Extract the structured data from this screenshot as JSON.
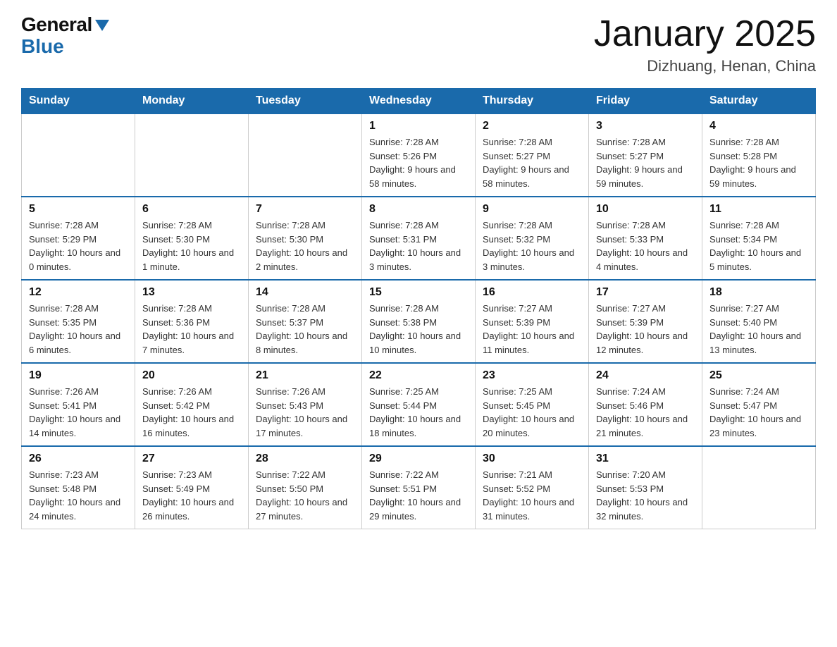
{
  "logo": {
    "general": "General",
    "blue": "Blue"
  },
  "title": "January 2025",
  "subtitle": "Dizhuang, Henan, China",
  "weekdays": [
    "Sunday",
    "Monday",
    "Tuesday",
    "Wednesday",
    "Thursday",
    "Friday",
    "Saturday"
  ],
  "weeks": [
    [
      {
        "day": "",
        "info": ""
      },
      {
        "day": "",
        "info": ""
      },
      {
        "day": "",
        "info": ""
      },
      {
        "day": "1",
        "info": "Sunrise: 7:28 AM\nSunset: 5:26 PM\nDaylight: 9 hours\nand 58 minutes."
      },
      {
        "day": "2",
        "info": "Sunrise: 7:28 AM\nSunset: 5:27 PM\nDaylight: 9 hours\nand 58 minutes."
      },
      {
        "day": "3",
        "info": "Sunrise: 7:28 AM\nSunset: 5:27 PM\nDaylight: 9 hours\nand 59 minutes."
      },
      {
        "day": "4",
        "info": "Sunrise: 7:28 AM\nSunset: 5:28 PM\nDaylight: 9 hours\nand 59 minutes."
      }
    ],
    [
      {
        "day": "5",
        "info": "Sunrise: 7:28 AM\nSunset: 5:29 PM\nDaylight: 10 hours\nand 0 minutes."
      },
      {
        "day": "6",
        "info": "Sunrise: 7:28 AM\nSunset: 5:30 PM\nDaylight: 10 hours\nand 1 minute."
      },
      {
        "day": "7",
        "info": "Sunrise: 7:28 AM\nSunset: 5:30 PM\nDaylight: 10 hours\nand 2 minutes."
      },
      {
        "day": "8",
        "info": "Sunrise: 7:28 AM\nSunset: 5:31 PM\nDaylight: 10 hours\nand 3 minutes."
      },
      {
        "day": "9",
        "info": "Sunrise: 7:28 AM\nSunset: 5:32 PM\nDaylight: 10 hours\nand 3 minutes."
      },
      {
        "day": "10",
        "info": "Sunrise: 7:28 AM\nSunset: 5:33 PM\nDaylight: 10 hours\nand 4 minutes."
      },
      {
        "day": "11",
        "info": "Sunrise: 7:28 AM\nSunset: 5:34 PM\nDaylight: 10 hours\nand 5 minutes."
      }
    ],
    [
      {
        "day": "12",
        "info": "Sunrise: 7:28 AM\nSunset: 5:35 PM\nDaylight: 10 hours\nand 6 minutes."
      },
      {
        "day": "13",
        "info": "Sunrise: 7:28 AM\nSunset: 5:36 PM\nDaylight: 10 hours\nand 7 minutes."
      },
      {
        "day": "14",
        "info": "Sunrise: 7:28 AM\nSunset: 5:37 PM\nDaylight: 10 hours\nand 8 minutes."
      },
      {
        "day": "15",
        "info": "Sunrise: 7:28 AM\nSunset: 5:38 PM\nDaylight: 10 hours\nand 10 minutes."
      },
      {
        "day": "16",
        "info": "Sunrise: 7:27 AM\nSunset: 5:39 PM\nDaylight: 10 hours\nand 11 minutes."
      },
      {
        "day": "17",
        "info": "Sunrise: 7:27 AM\nSunset: 5:39 PM\nDaylight: 10 hours\nand 12 minutes."
      },
      {
        "day": "18",
        "info": "Sunrise: 7:27 AM\nSunset: 5:40 PM\nDaylight: 10 hours\nand 13 minutes."
      }
    ],
    [
      {
        "day": "19",
        "info": "Sunrise: 7:26 AM\nSunset: 5:41 PM\nDaylight: 10 hours\nand 14 minutes."
      },
      {
        "day": "20",
        "info": "Sunrise: 7:26 AM\nSunset: 5:42 PM\nDaylight: 10 hours\nand 16 minutes."
      },
      {
        "day": "21",
        "info": "Sunrise: 7:26 AM\nSunset: 5:43 PM\nDaylight: 10 hours\nand 17 minutes."
      },
      {
        "day": "22",
        "info": "Sunrise: 7:25 AM\nSunset: 5:44 PM\nDaylight: 10 hours\nand 18 minutes."
      },
      {
        "day": "23",
        "info": "Sunrise: 7:25 AM\nSunset: 5:45 PM\nDaylight: 10 hours\nand 20 minutes."
      },
      {
        "day": "24",
        "info": "Sunrise: 7:24 AM\nSunset: 5:46 PM\nDaylight: 10 hours\nand 21 minutes."
      },
      {
        "day": "25",
        "info": "Sunrise: 7:24 AM\nSunset: 5:47 PM\nDaylight: 10 hours\nand 23 minutes."
      }
    ],
    [
      {
        "day": "26",
        "info": "Sunrise: 7:23 AM\nSunset: 5:48 PM\nDaylight: 10 hours\nand 24 minutes."
      },
      {
        "day": "27",
        "info": "Sunrise: 7:23 AM\nSunset: 5:49 PM\nDaylight: 10 hours\nand 26 minutes."
      },
      {
        "day": "28",
        "info": "Sunrise: 7:22 AM\nSunset: 5:50 PM\nDaylight: 10 hours\nand 27 minutes."
      },
      {
        "day": "29",
        "info": "Sunrise: 7:22 AM\nSunset: 5:51 PM\nDaylight: 10 hours\nand 29 minutes."
      },
      {
        "day": "30",
        "info": "Sunrise: 7:21 AM\nSunset: 5:52 PM\nDaylight: 10 hours\nand 31 minutes."
      },
      {
        "day": "31",
        "info": "Sunrise: 7:20 AM\nSunset: 5:53 PM\nDaylight: 10 hours\nand 32 minutes."
      },
      {
        "day": "",
        "info": ""
      }
    ]
  ]
}
